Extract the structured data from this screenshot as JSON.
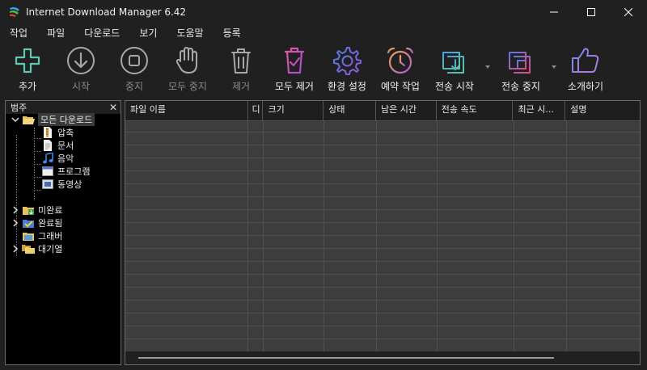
{
  "window": {
    "title": "Internet Download Manager 6.42"
  },
  "menu": [
    "작업",
    "파일",
    "다운로드",
    "보기",
    "도움말",
    "등록"
  ],
  "toolbar": [
    {
      "label": "추가",
      "icon": "plus-icon",
      "enabled": true
    },
    {
      "label": "시작",
      "icon": "download-arrow-icon",
      "enabled": false
    },
    {
      "label": "중지",
      "icon": "stop-icon",
      "enabled": false
    },
    {
      "label": "모두 중지",
      "icon": "hand-icon",
      "enabled": false
    },
    {
      "label": "제거",
      "icon": "trash-icon",
      "enabled": false
    },
    {
      "label": "모두 제거",
      "icon": "trash-all-icon",
      "enabled": true
    },
    {
      "label": "환경 설정",
      "icon": "gear-icon",
      "enabled": true
    },
    {
      "label": "예약 작업",
      "icon": "alarm-clock-icon",
      "enabled": true
    },
    {
      "label": "전송 시작",
      "icon": "queue-start-icon",
      "enabled": true
    },
    {
      "label": "전송 중지",
      "icon": "queue-stop-icon",
      "enabled": true
    },
    {
      "label": "소개하기",
      "icon": "thumbs-up-icon",
      "enabled": true
    }
  ],
  "categories": {
    "header": "범주",
    "close_glyph": "✕",
    "all_downloads": "모든 다운로드",
    "children": [
      "압축",
      "문서",
      "음악",
      "프로그램",
      "동영상"
    ],
    "unfinished": "미완료",
    "finished": "완료됨",
    "grabber": "그래버",
    "queues": "대기열"
  },
  "columns": [
    "파일 이름",
    "디",
    "크기",
    "상태",
    "남은 시간",
    "전송 속도",
    "최근 시...",
    "설명"
  ]
}
